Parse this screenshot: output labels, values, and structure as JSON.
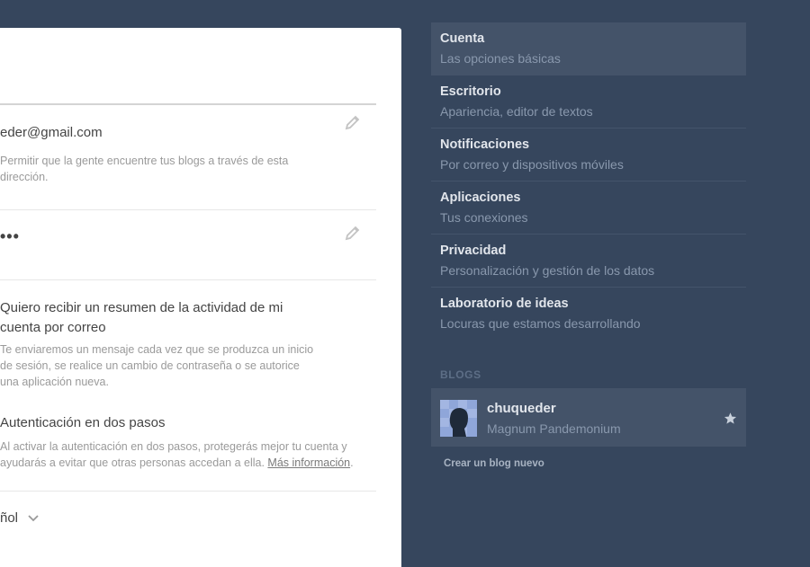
{
  "account": {
    "email": "eder@gmail.com",
    "email_desc": "Permitir que la gente encuentre tus blogs a través de esta dirección.",
    "password_mask": "•••",
    "digest_title": "Quiero recibir un resumen de la actividad de mi cuenta por correo",
    "digest_desc": "Te enviaremos un mensaje cada vez que se produzca un inicio de sesión, se realice un cambio de contraseña o se autorice una aplicación nueva.",
    "twofa_title": "Autenticación en dos pasos",
    "twofa_desc": "Al activar la autenticación en dos pasos, protegerás mejor tu cuenta y ayudarás a evitar que otras personas accedan a ella.",
    "twofa_link": "Más información",
    "language_value": "ñol"
  },
  "sidebar": {
    "items": [
      {
        "title": "Cuenta",
        "subtitle": "Las opciones básicas"
      },
      {
        "title": "Escritorio",
        "subtitle": "Apariencia, editor de textos"
      },
      {
        "title": "Notificaciones",
        "subtitle": "Por correo y dispositivos móviles"
      },
      {
        "title": "Aplicaciones",
        "subtitle": "Tus conexiones"
      },
      {
        "title": "Privacidad",
        "subtitle": "Personalización y gestión de los datos"
      },
      {
        "title": "Laboratorio de ideas",
        "subtitle": "Locuras que estamos desarrollando"
      }
    ],
    "blogs_label": "BLOGS",
    "blog": {
      "name": "chuqueder",
      "subtitle": "Magnum Pandemonium"
    },
    "new_blog_label": "Crear un blog nuevo"
  },
  "colors": {
    "background": "#36465d",
    "active_item": "#445369",
    "panel": "#ffffff"
  }
}
